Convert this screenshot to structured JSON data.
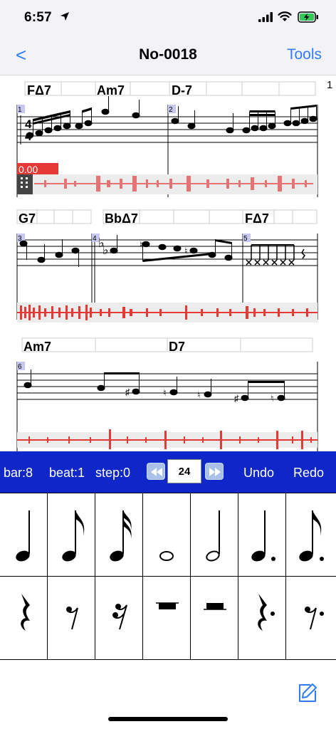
{
  "status_bar": {
    "time": "6:57"
  },
  "nav": {
    "back_label": "<",
    "title": "No-0018",
    "tools_label": "Tools"
  },
  "score": {
    "page_number": "1",
    "rows": [
      {
        "chords": [
          "FΔ7",
          "Am7",
          "D-7"
        ],
        "measures": [
          "1",
          "2"
        ],
        "time_signature": "4/4"
      },
      {
        "chords": [
          "G7",
          "BbΔ7",
          "FΔ7"
        ],
        "measures": [
          "3",
          "4",
          "5"
        ]
      },
      {
        "chords": [
          "Am7",
          "D7"
        ],
        "measures": [
          "6"
        ]
      }
    ],
    "playback_time": "0.00"
  },
  "toolbar": {
    "bar_label": "bar:8",
    "beat_label": "beat:1",
    "step_label": "step:0",
    "tempo_value": "24",
    "undo_label": "Undo",
    "redo_label": "Redo"
  },
  "palette": {
    "notes": [
      "quarter-note",
      "eighth-note",
      "sixteenth-note",
      "whole-note",
      "half-note",
      "dotted-quarter-note",
      "dotted-eighth-note"
    ],
    "rests": [
      "quarter-rest",
      "eighth-rest",
      "sixteenth-rest",
      "whole-rest",
      "half-rest",
      "dotted-quarter-rest",
      "dotted-eighth-rest"
    ]
  },
  "colors": {
    "accent": "#2f7cf6",
    "toolbar": "#0f27c8",
    "waveform": "#e53935",
    "measure_label_bg": "#c7c7f0"
  }
}
